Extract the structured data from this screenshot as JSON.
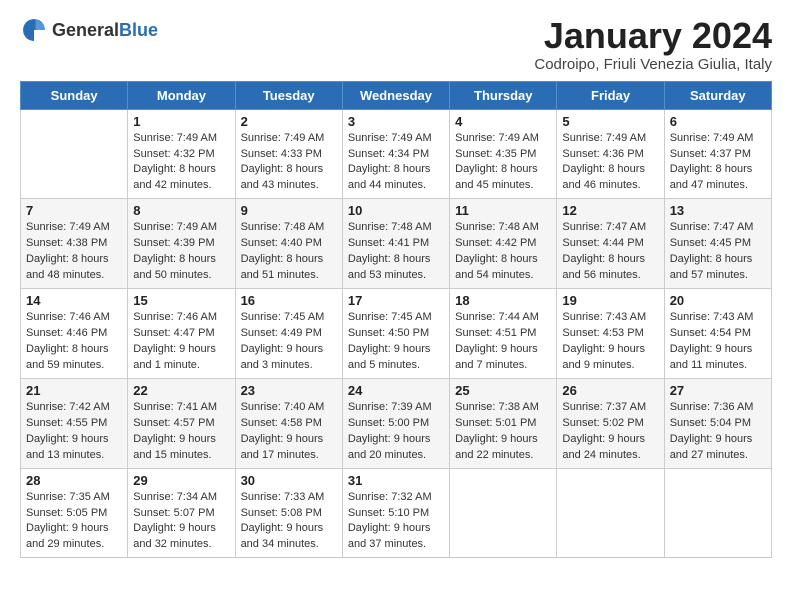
{
  "logo": {
    "general": "General",
    "blue": "Blue"
  },
  "header": {
    "title": "January 2024",
    "subtitle": "Codroipo, Friuli Venezia Giulia, Italy"
  },
  "weekdays": [
    "Sunday",
    "Monday",
    "Tuesday",
    "Wednesday",
    "Thursday",
    "Friday",
    "Saturday"
  ],
  "weeks": [
    [
      {
        "day": "",
        "sunrise": "",
        "sunset": "",
        "daylight": ""
      },
      {
        "day": "1",
        "sunrise": "Sunrise: 7:49 AM",
        "sunset": "Sunset: 4:32 PM",
        "daylight": "Daylight: 8 hours and 42 minutes."
      },
      {
        "day": "2",
        "sunrise": "Sunrise: 7:49 AM",
        "sunset": "Sunset: 4:33 PM",
        "daylight": "Daylight: 8 hours and 43 minutes."
      },
      {
        "day": "3",
        "sunrise": "Sunrise: 7:49 AM",
        "sunset": "Sunset: 4:34 PM",
        "daylight": "Daylight: 8 hours and 44 minutes."
      },
      {
        "day": "4",
        "sunrise": "Sunrise: 7:49 AM",
        "sunset": "Sunset: 4:35 PM",
        "daylight": "Daylight: 8 hours and 45 minutes."
      },
      {
        "day": "5",
        "sunrise": "Sunrise: 7:49 AM",
        "sunset": "Sunset: 4:36 PM",
        "daylight": "Daylight: 8 hours and 46 minutes."
      },
      {
        "day": "6",
        "sunrise": "Sunrise: 7:49 AM",
        "sunset": "Sunset: 4:37 PM",
        "daylight": "Daylight: 8 hours and 47 minutes."
      }
    ],
    [
      {
        "day": "7",
        "sunrise": "Sunrise: 7:49 AM",
        "sunset": "Sunset: 4:38 PM",
        "daylight": "Daylight: 8 hours and 48 minutes."
      },
      {
        "day": "8",
        "sunrise": "Sunrise: 7:49 AM",
        "sunset": "Sunset: 4:39 PM",
        "daylight": "Daylight: 8 hours and 50 minutes."
      },
      {
        "day": "9",
        "sunrise": "Sunrise: 7:48 AM",
        "sunset": "Sunset: 4:40 PM",
        "daylight": "Daylight: 8 hours and 51 minutes."
      },
      {
        "day": "10",
        "sunrise": "Sunrise: 7:48 AM",
        "sunset": "Sunset: 4:41 PM",
        "daylight": "Daylight: 8 hours and 53 minutes."
      },
      {
        "day": "11",
        "sunrise": "Sunrise: 7:48 AM",
        "sunset": "Sunset: 4:42 PM",
        "daylight": "Daylight: 8 hours and 54 minutes."
      },
      {
        "day": "12",
        "sunrise": "Sunrise: 7:47 AM",
        "sunset": "Sunset: 4:44 PM",
        "daylight": "Daylight: 8 hours and 56 minutes."
      },
      {
        "day": "13",
        "sunrise": "Sunrise: 7:47 AM",
        "sunset": "Sunset: 4:45 PM",
        "daylight": "Daylight: 8 hours and 57 minutes."
      }
    ],
    [
      {
        "day": "14",
        "sunrise": "Sunrise: 7:46 AM",
        "sunset": "Sunset: 4:46 PM",
        "daylight": "Daylight: 8 hours and 59 minutes."
      },
      {
        "day": "15",
        "sunrise": "Sunrise: 7:46 AM",
        "sunset": "Sunset: 4:47 PM",
        "daylight": "Daylight: 9 hours and 1 minute."
      },
      {
        "day": "16",
        "sunrise": "Sunrise: 7:45 AM",
        "sunset": "Sunset: 4:49 PM",
        "daylight": "Daylight: 9 hours and 3 minutes."
      },
      {
        "day": "17",
        "sunrise": "Sunrise: 7:45 AM",
        "sunset": "Sunset: 4:50 PM",
        "daylight": "Daylight: 9 hours and 5 minutes."
      },
      {
        "day": "18",
        "sunrise": "Sunrise: 7:44 AM",
        "sunset": "Sunset: 4:51 PM",
        "daylight": "Daylight: 9 hours and 7 minutes."
      },
      {
        "day": "19",
        "sunrise": "Sunrise: 7:43 AM",
        "sunset": "Sunset: 4:53 PM",
        "daylight": "Daylight: 9 hours and 9 minutes."
      },
      {
        "day": "20",
        "sunrise": "Sunrise: 7:43 AM",
        "sunset": "Sunset: 4:54 PM",
        "daylight": "Daylight: 9 hours and 11 minutes."
      }
    ],
    [
      {
        "day": "21",
        "sunrise": "Sunrise: 7:42 AM",
        "sunset": "Sunset: 4:55 PM",
        "daylight": "Daylight: 9 hours and 13 minutes."
      },
      {
        "day": "22",
        "sunrise": "Sunrise: 7:41 AM",
        "sunset": "Sunset: 4:57 PM",
        "daylight": "Daylight: 9 hours and 15 minutes."
      },
      {
        "day": "23",
        "sunrise": "Sunrise: 7:40 AM",
        "sunset": "Sunset: 4:58 PM",
        "daylight": "Daylight: 9 hours and 17 minutes."
      },
      {
        "day": "24",
        "sunrise": "Sunrise: 7:39 AM",
        "sunset": "Sunset: 5:00 PM",
        "daylight": "Daylight: 9 hours and 20 minutes."
      },
      {
        "day": "25",
        "sunrise": "Sunrise: 7:38 AM",
        "sunset": "Sunset: 5:01 PM",
        "daylight": "Daylight: 9 hours and 22 minutes."
      },
      {
        "day": "26",
        "sunrise": "Sunrise: 7:37 AM",
        "sunset": "Sunset: 5:02 PM",
        "daylight": "Daylight: 9 hours and 24 minutes."
      },
      {
        "day": "27",
        "sunrise": "Sunrise: 7:36 AM",
        "sunset": "Sunset: 5:04 PM",
        "daylight": "Daylight: 9 hours and 27 minutes."
      }
    ],
    [
      {
        "day": "28",
        "sunrise": "Sunrise: 7:35 AM",
        "sunset": "Sunset: 5:05 PM",
        "daylight": "Daylight: 9 hours and 29 minutes."
      },
      {
        "day": "29",
        "sunrise": "Sunrise: 7:34 AM",
        "sunset": "Sunset: 5:07 PM",
        "daylight": "Daylight: 9 hours and 32 minutes."
      },
      {
        "day": "30",
        "sunrise": "Sunrise: 7:33 AM",
        "sunset": "Sunset: 5:08 PM",
        "daylight": "Daylight: 9 hours and 34 minutes."
      },
      {
        "day": "31",
        "sunrise": "Sunrise: 7:32 AM",
        "sunset": "Sunset: 5:10 PM",
        "daylight": "Daylight: 9 hours and 37 minutes."
      },
      {
        "day": "",
        "sunrise": "",
        "sunset": "",
        "daylight": ""
      },
      {
        "day": "",
        "sunrise": "",
        "sunset": "",
        "daylight": ""
      },
      {
        "day": "",
        "sunrise": "",
        "sunset": "",
        "daylight": ""
      }
    ]
  ]
}
